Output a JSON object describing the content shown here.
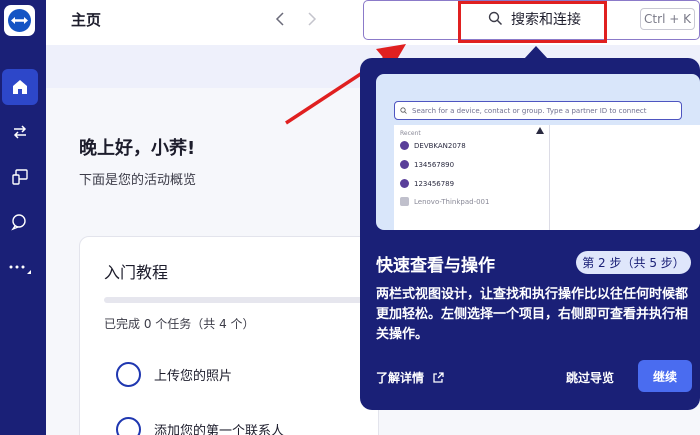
{
  "header": {
    "title": "主页",
    "search_text": "搜索和连接",
    "shortcut": "Ctrl + K"
  },
  "main": {
    "greeting": "晚上好，小荞!",
    "subtitle": "下面是您的活动概览",
    "tutorial": {
      "title": "入门教程",
      "progress_text": "已完成 0 个任务（共 4 个）",
      "progress": 0,
      "tasks": [
        "上传您的照片",
        "添加您的第一个联系人"
      ]
    }
  },
  "popover": {
    "preview": {
      "search_placeholder": "Search for a device, contact or group. Type a partner ID to connect",
      "recent_label": "Recent",
      "devices": [
        "DEVBKAN2078",
        "134567890",
        "123456789",
        "Lenovo-Thinkpad-001"
      ]
    },
    "title": "快速查看与操作",
    "step": "第 2 步（共 5 步）",
    "body": "两栏式视图设计，让查找和执行操作比以往任何时候都更加轻松。左侧选择一个项目，右侧即可查看并执行相关操作。",
    "learn_more": "了解详情",
    "skip": "跳过导览",
    "continue": "继续"
  },
  "colors": {
    "sidebar": "#1a2077",
    "popover": "#1a2077",
    "accent": "#4a6cf0",
    "annotation": "#e02020"
  }
}
